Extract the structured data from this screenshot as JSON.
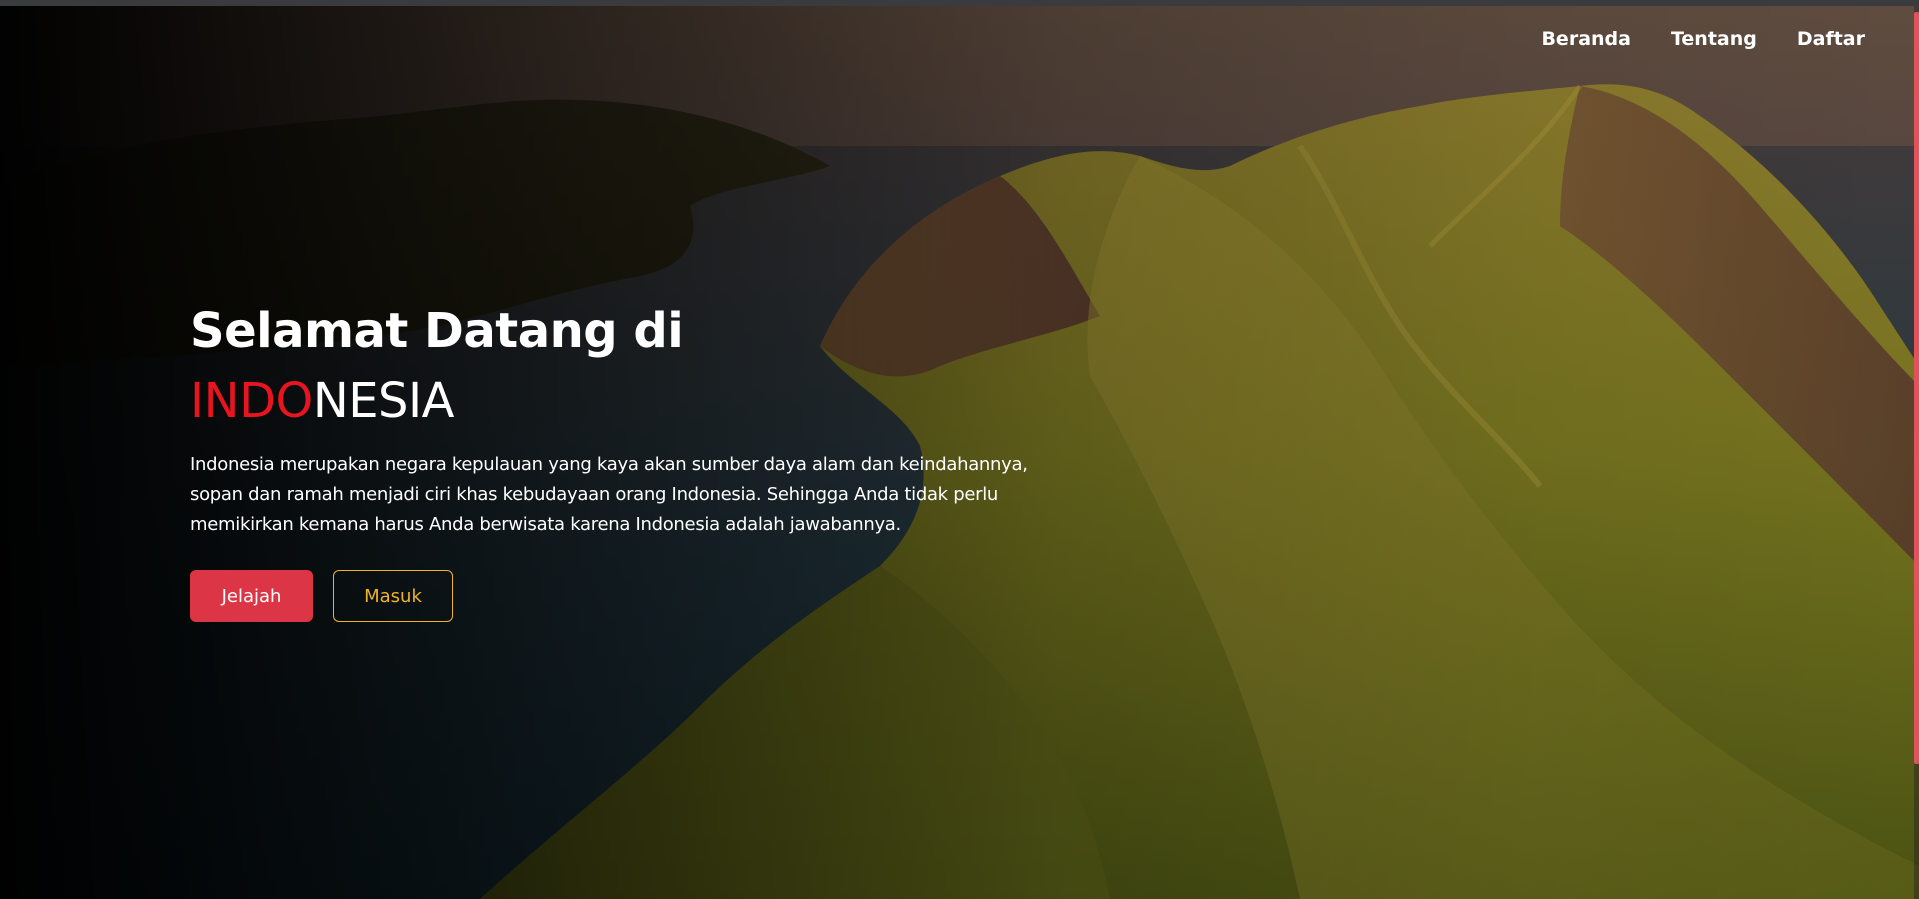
{
  "nav": {
    "items": [
      {
        "label": "Beranda"
      },
      {
        "label": "Tentang"
      },
      {
        "label": "Daftar"
      }
    ]
  },
  "hero": {
    "title_line1": "Selamat Datang di",
    "title_red": "INDO",
    "title_white": "NESIA",
    "description": "Indonesia merupakan negara kepulauan yang kaya akan sumber daya alam dan keindahannya, sopan dan ramah menjadi ciri khas kebudayaan orang Indonesia. Sehingga Anda tidak perlu memikirkan kemana harus Anda berwisata karena Indonesia adalah jawabannya.",
    "primary_button": "Jelajah",
    "secondary_button": "Masuk"
  },
  "colors": {
    "accent_red": "#dc3545",
    "title_red": "#e8141f",
    "outline_yellow": "#f0b429",
    "scroll_thumb": "#e0535a"
  }
}
